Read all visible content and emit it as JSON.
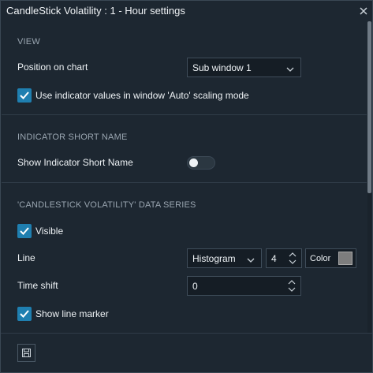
{
  "window": {
    "title": "CandleStick Volatility : 1 - Hour settings"
  },
  "view": {
    "heading": "VIEW",
    "position_label": "Position on chart",
    "position_value": "Sub window 1",
    "autoscale_label": "Use indicator values in window 'Auto' scaling mode",
    "autoscale_checked": true
  },
  "short_name": {
    "heading": "INDICATOR SHORT NAME",
    "show_label": "Show Indicator Short Name",
    "show_enabled": false
  },
  "series": {
    "heading": "'CANDLESTICK VOLATILITY' DATA SERIES",
    "visible_label": "Visible",
    "visible_checked": true,
    "line_label": "Line",
    "line_type": "Histogram",
    "line_width": "4",
    "color_label": "Color",
    "color_value": "#7d7d7d",
    "time_shift_label": "Time shift",
    "time_shift_value": "0",
    "marker_label": "Show line marker",
    "marker_checked": true
  },
  "icons": {
    "close": "close-icon",
    "save": "save-icon",
    "chevron": "chevron-down-icon",
    "check": "check-icon",
    "stepper": "stepper-arrows-icon"
  },
  "colors": {
    "background": "#1d2731",
    "accent": "#1f7fb0",
    "input_bg": "#151d25",
    "muted_text": "#9aa6b1"
  }
}
